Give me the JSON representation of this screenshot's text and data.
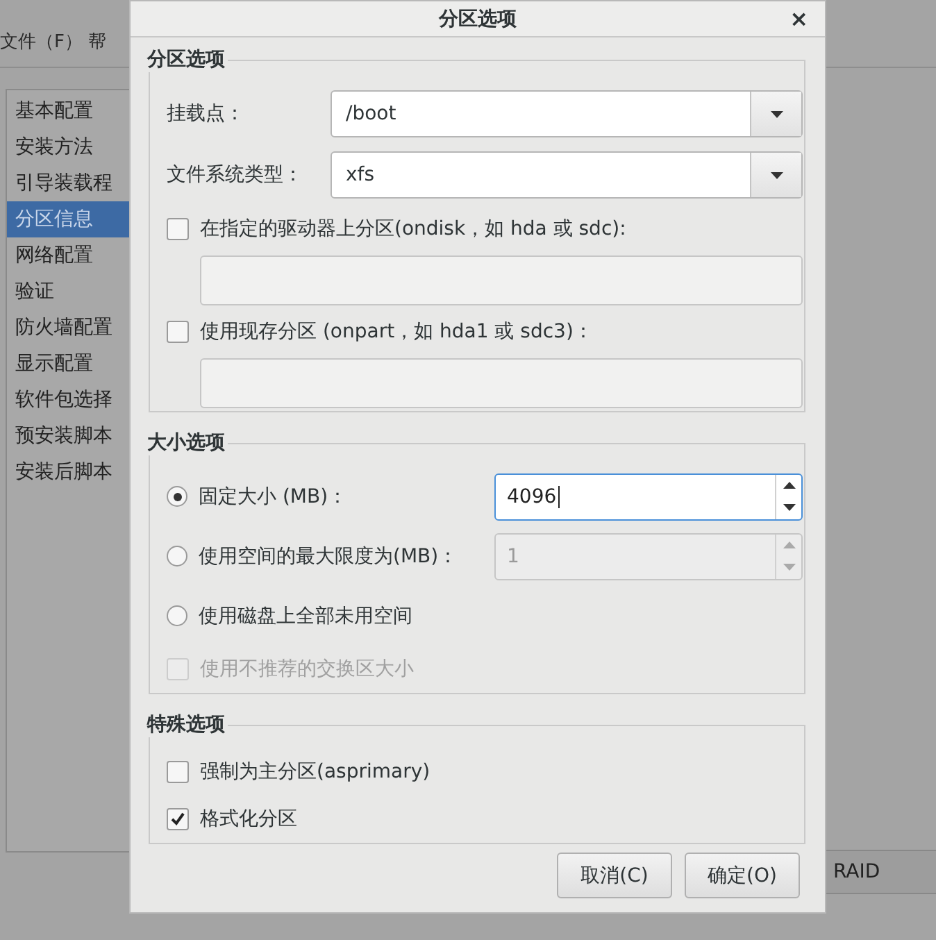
{
  "background": {
    "menu": [
      "文件（F）",
      "帮"
    ],
    "sidebar": [
      {
        "label": "基本配置",
        "selected": false
      },
      {
        "label": "安装方法",
        "selected": false
      },
      {
        "label": "引导装载程",
        "selected": false
      },
      {
        "label": "分区信息",
        "selected": true
      },
      {
        "label": "网络配置",
        "selected": false
      },
      {
        "label": "验证",
        "selected": false
      },
      {
        "label": "防火墙配置",
        "selected": false
      },
      {
        "label": "显示配置",
        "selected": false
      },
      {
        "label": "软件包选择",
        "selected": false
      },
      {
        "label": "预安装脚本",
        "selected": false
      },
      {
        "label": "安装后脚本",
        "selected": false
      }
    ],
    "side_button": "RAID"
  },
  "dialog": {
    "title": "分区选项",
    "close": "×",
    "sections": [
      {
        "title": "分区选项",
        "rows": [
          {
            "kind": "combo",
            "label": "挂载点：",
            "value": "/boot"
          },
          {
            "kind": "combo",
            "label": "文件系统类型：",
            "value": "xfs"
          },
          {
            "kind": "checkbox",
            "label": "在指定的驱动器上分区(ondisk，如 hda 或 sdc):",
            "checked": false,
            "disabled": false
          },
          {
            "kind": "entry"
          },
          {
            "kind": "checkbox",
            "label": "使用现存分区 (onpart，如 hda1 或 sdc3)：",
            "checked": false,
            "disabled": false
          },
          {
            "kind": "entry"
          }
        ]
      },
      {
        "title": "大小选项",
        "rows": [
          {
            "kind": "radio",
            "label": "固定大小 (MB)：",
            "selected": true,
            "spin": {
              "value": "4096",
              "disabled": false,
              "focused": true
            }
          },
          {
            "kind": "radio",
            "label": "使用空间的最大限度为(MB)：",
            "selected": false,
            "spin": {
              "value": "1",
              "disabled": true,
              "focused": false
            }
          },
          {
            "kind": "radio",
            "label": "使用磁盘上全部未用空间",
            "selected": false
          },
          {
            "kind": "checkbox",
            "label": "使用不推荐的交换区大小",
            "checked": false,
            "disabled": true
          }
        ]
      },
      {
        "title": "特殊选项",
        "rows": [
          {
            "kind": "checkbox",
            "label": "强制为主分区(asprimary)",
            "checked": false,
            "disabled": false
          },
          {
            "kind": "checkbox",
            "label": "格式化分区",
            "checked": true,
            "disabled": false
          }
        ]
      }
    ],
    "buttons": [
      "取消(C)",
      "确定(O)"
    ]
  }
}
